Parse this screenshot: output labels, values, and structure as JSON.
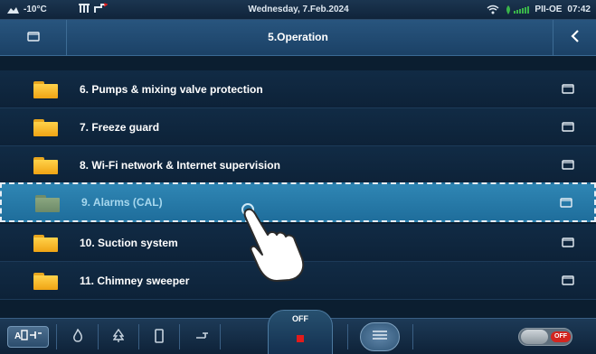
{
  "status_bar": {
    "temperature": "-10°C",
    "date": "Wednesday, 7.Feb.2024",
    "device": "PII-OE",
    "time": "07:42",
    "icons": [
      "cloud-icon",
      "grid-icon",
      "pipe-icon",
      "wifi-icon",
      "leaf-signal-icon"
    ],
    "colors": {
      "signal": "#3ab54a"
    }
  },
  "header": {
    "title": "5.Operation",
    "left_icon": "folder-outline-icon",
    "back_icon": "chevron-left-icon"
  },
  "menu": {
    "items": [
      {
        "label": "6.  Pumps & mixing valve protection",
        "selected": false
      },
      {
        "label": "7.  Freeze guard",
        "selected": false
      },
      {
        "label": "8.  Wi-Fi network & Internet supervision",
        "selected": false
      },
      {
        "label": "9.  Alarms (CAL)",
        "selected": true
      },
      {
        "label": "10. Suction system",
        "selected": false
      },
      {
        "label": "11. Chimney sweeper",
        "selected": false
      }
    ],
    "colors": {
      "folder": "#f5b51d",
      "selected_bg": "#2a7eae"
    }
  },
  "bottom_bar": {
    "off_label": "OFF",
    "toggle_label": "OFF",
    "icons": [
      "auto-mode-icon",
      "flame-icon",
      "tree-icon",
      "boiler-icon",
      "pump-icon",
      "stop-icon",
      "menu-icon",
      "power-toggle-icon"
    ],
    "colors": {
      "stop": "#e21b1b",
      "toggle_label": "#d3251f"
    }
  }
}
